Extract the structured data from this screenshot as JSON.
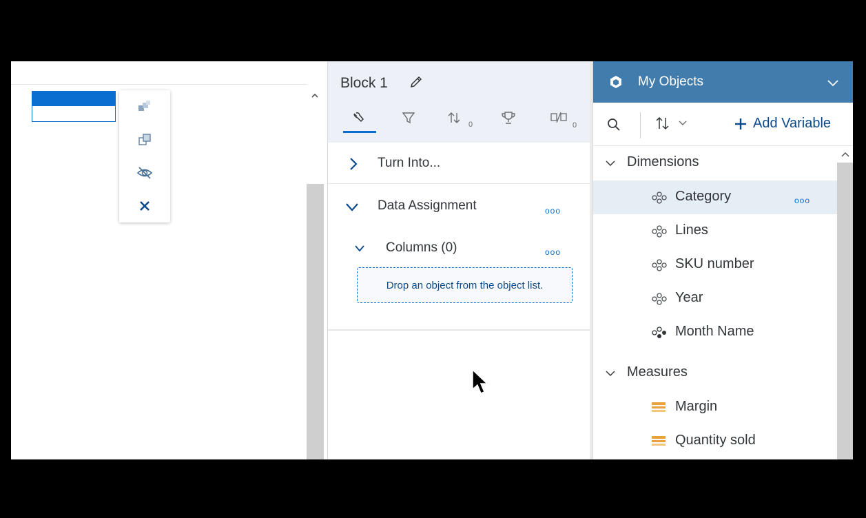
{
  "canvas": {
    "toolbar_icons": [
      "group-icon",
      "duplicate-icon",
      "hide-icon",
      "close-icon"
    ]
  },
  "block_panel": {
    "title": "Block 1",
    "tabs": [
      {
        "icon": "wrench-icon",
        "count": ""
      },
      {
        "icon": "filter-icon",
        "count": ""
      },
      {
        "icon": "sort-icon",
        "count": "0"
      },
      {
        "icon": "trophy-icon",
        "count": ""
      },
      {
        "icon": "break-icon",
        "count": "0"
      }
    ],
    "turn_into_label": "Turn Into...",
    "data_assignment_label": "Data Assignment",
    "columns_label": "Columns (0)",
    "drop_zone_text": "Drop an object from the object list.",
    "more_dots": "ooo"
  },
  "objects_panel": {
    "title": "My Objects",
    "add_variable_label": "Add Variable",
    "dimensions_label": "Dimensions",
    "dimensions": [
      "Category",
      "Lines",
      "SKU number",
      "Year",
      "Month Name"
    ],
    "measures_label": "Measures",
    "measures": [
      "Margin",
      "Quantity sold"
    ],
    "more_dots": "ooo"
  },
  "colors": {
    "accent": "#0a6ed1",
    "header_blue": "#427cac",
    "measure_orange": "#e9a23b",
    "selection": "#e5edf5"
  }
}
